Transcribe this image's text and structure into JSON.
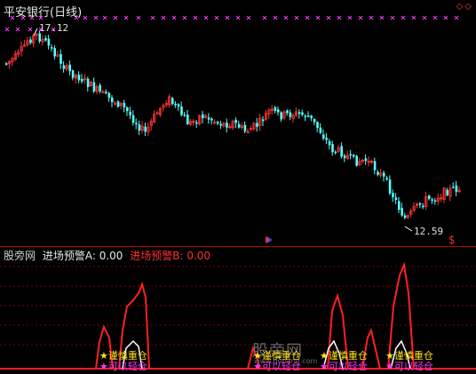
{
  "window": {
    "title": "平安银行(日线)",
    "corner_marks": "◇◇"
  },
  "price_chart": {
    "high_label": "17.12",
    "low_label": "12.59",
    "signal_mark": "$"
  },
  "indicator": {
    "name": "股旁网",
    "a_label": "进场预警A: 0.00",
    "b_label": "进场预警B: 0.00"
  },
  "watermark": {
    "main": "股旁网",
    "sub": "www.gupang.com"
  },
  "markers": {
    "star_yellow": "★谨慎重仓",
    "star_magenta": "★可以轻仓"
  },
  "colors": {
    "up_candle": "#ff3333",
    "down_candle": "#54ffff",
    "signal_line": "#ff2020",
    "cross_marker": "#ff33ff",
    "white_line": "#ffffff"
  }
}
